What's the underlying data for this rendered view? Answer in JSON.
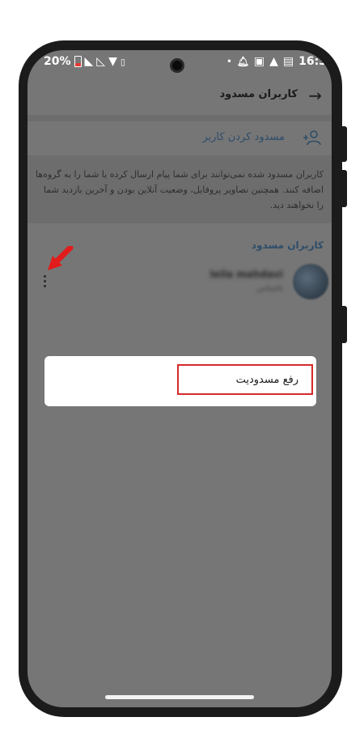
{
  "status_bar": {
    "battery": "20%",
    "time": "16:3"
  },
  "header": {
    "back_icon": "arrow-right-icon",
    "title": "کاربران مسدود"
  },
  "block_user": {
    "icon": "add-person-icon",
    "label": "مسدود کردن کاربر"
  },
  "description": "کاربران مسدود شده نمی‌توانند برای شما پیام ارسال کرده یا شما را به گروه‌ها اضافه کنند. همچنین تصاویر پروفایل، وضعیت آنلاین بودن و آخرین بازدید شما را نخواهند دید.",
  "section": {
    "title": "کاربران مسدود"
  },
  "blocked_user": {
    "name": "leila mahdavi",
    "subtitle": "ناشناس"
  },
  "popup": {
    "unblock_label": "رفع مسدودیت"
  },
  "colors": {
    "accent": "#2d4d6a",
    "highlight": "#d62a2a",
    "overlay": "#767676"
  }
}
